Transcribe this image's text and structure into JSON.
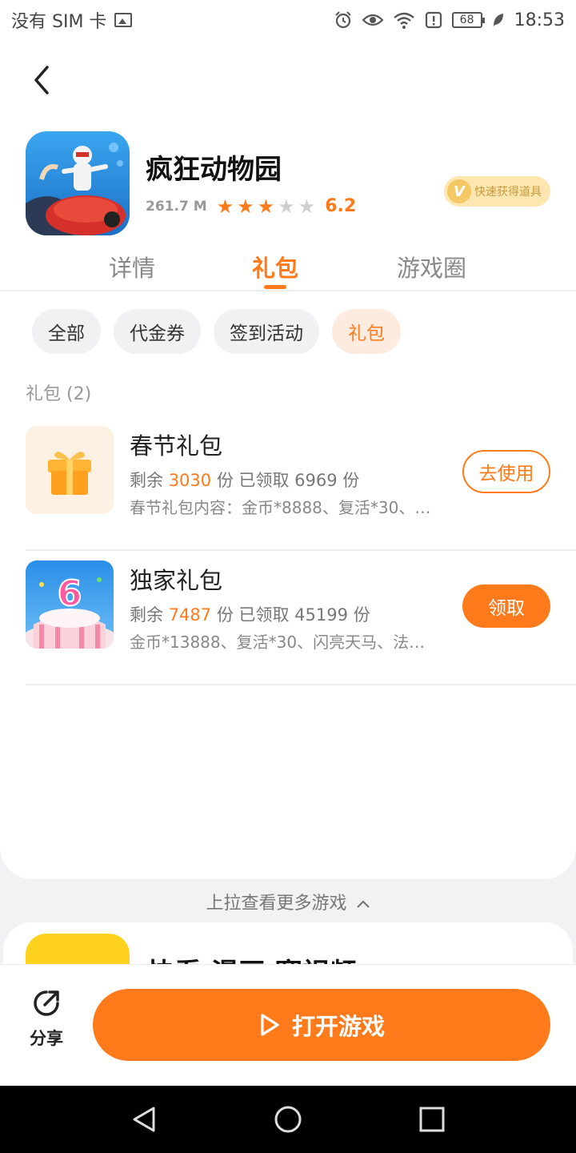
{
  "status_bar": {
    "carrier": "没有 SIM 卡",
    "battery": "68",
    "time": "18:53"
  },
  "app": {
    "name": "疯狂动物园",
    "size": "261.7 M",
    "rating": "6.2",
    "rating_stars": 3,
    "vip_badge": "快速获得道具",
    "vip_mark": "V"
  },
  "tabs": [
    {
      "label": "详情",
      "active": false
    },
    {
      "label": "礼包",
      "active": true
    },
    {
      "label": "游戏圈",
      "active": false
    }
  ],
  "chips": [
    {
      "label": "全部",
      "active": false
    },
    {
      "label": "代金券",
      "active": false
    },
    {
      "label": "签到活动",
      "active": false
    },
    {
      "label": "礼包",
      "active": true
    }
  ],
  "section_label": "礼包 (2)",
  "gifts": [
    {
      "title": "春节礼包",
      "remaining_prefix": "剩余",
      "remaining": "3030",
      "claimed_text": "份 已领取 6969 份",
      "description": "春节礼包内容：金币*8888、复活*30、…",
      "button": "去使用",
      "icon": "gift-box-icon"
    },
    {
      "title": "独家礼包",
      "remaining_prefix": "剩余",
      "remaining": "7487",
      "claimed_text": "份 已领取 45199 份",
      "description": "金币*13888、复活*30、闪亮天马、法…",
      "button": "领取",
      "icon": "birthday-cake-icon"
    }
  ],
  "pull_more": "上拉查看更多游戏",
  "peek_app": {
    "name": "快看 漫画 赛视频"
  },
  "bottom": {
    "share_label": "分享",
    "open_label": "打开游戏"
  },
  "colors": {
    "accent": "#ff7a1a",
    "chip_active_bg": "#fdebe0"
  }
}
